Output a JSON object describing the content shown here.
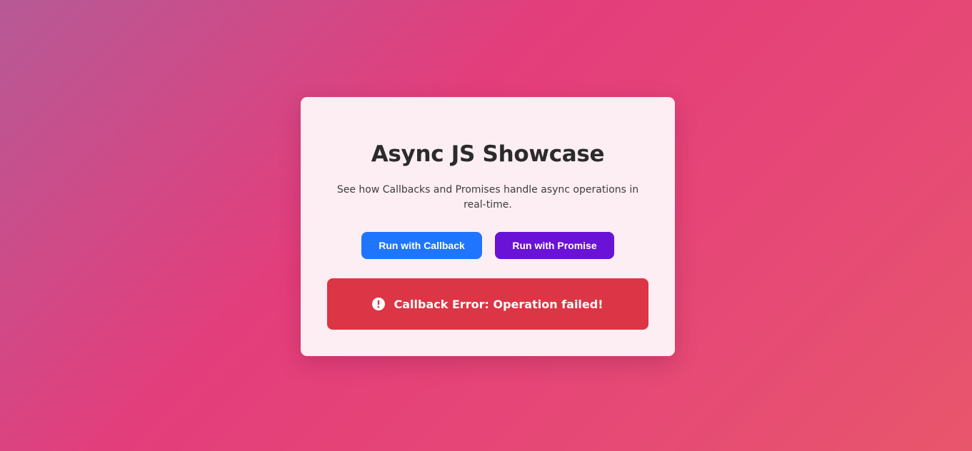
{
  "card": {
    "title": "Async JS Showcase",
    "subtitle": "See how Callbacks and Promises handle async operations in real-time."
  },
  "buttons": {
    "callback_label": "Run with Callback",
    "promise_label": "Run with Promise"
  },
  "alert": {
    "icon": "exclamation-circle-icon",
    "message": "Callback Error: Operation failed!"
  },
  "colors": {
    "callback_button": "#1f75fe",
    "promise_button": "#6a12d6",
    "error": "#dc3545",
    "card_background": "#fdeef3"
  }
}
